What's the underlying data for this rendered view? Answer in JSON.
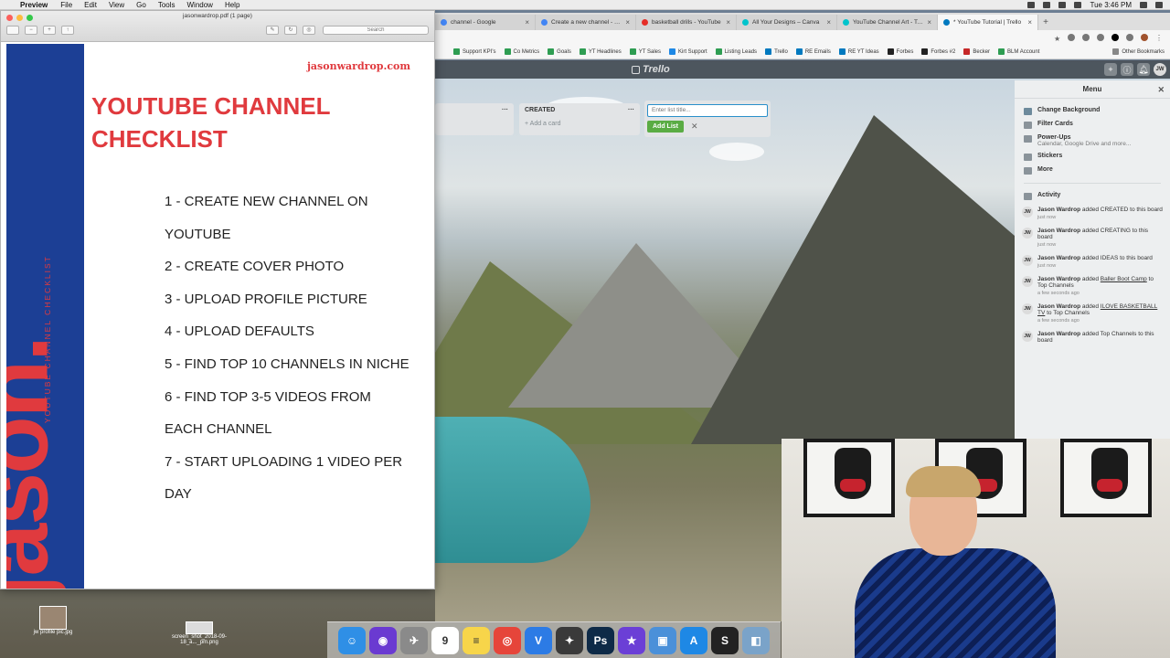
{
  "menubar": {
    "app": "Preview",
    "items": [
      "File",
      "Edit",
      "View",
      "Go",
      "Tools",
      "Window",
      "Help"
    ],
    "clock": "Tue 3:46 PM"
  },
  "chrome": {
    "tabs": [
      {
        "title": "channel - Google",
        "active": false,
        "color": "#4285f4"
      },
      {
        "title": "Create a new channel - YouTube",
        "active": false,
        "color": "#4285f4"
      },
      {
        "title": "basketball drills - YouTube",
        "active": false,
        "color": "#e52d27"
      },
      {
        "title": "All Your Designs – Canva",
        "active": false,
        "color": "#00c4cc"
      },
      {
        "title": "YouTube Channel Art - TextC",
        "active": false,
        "color": "#00c4cc"
      },
      {
        "title": "* YouTube Tutorial | Trello",
        "active": true,
        "color": "#0079bf"
      }
    ],
    "bookmarks": [
      "Support KPI's",
      "Co Metrics",
      "Goals",
      "YT Headlines",
      "YT Sales",
      "Kirt Support",
      "Listing Leads",
      "Trello",
      "RE Emails",
      "RE YT Ideas",
      "Forbes",
      "Forbes #2",
      "Becker",
      "BLM Account"
    ],
    "other_bookmarks": "Other Bookmarks"
  },
  "trello": {
    "logo": "Trello",
    "avatar": "JW",
    "lists": [
      {
        "title": "",
        "add_card": ""
      },
      {
        "title": "CREATED",
        "add_card": "+ Add a card"
      }
    ],
    "add_list": {
      "placeholder": "Enter list title...",
      "button": "Add List",
      "cancel": "✕"
    },
    "menu": {
      "title": "Menu",
      "close": "✕",
      "items": [
        {
          "label": "Change Background",
          "sub": ""
        },
        {
          "label": "Filter Cards",
          "sub": ""
        },
        {
          "label": "Power-Ups",
          "sub": "Calendar, Google Drive and more..."
        },
        {
          "label": "Stickers",
          "sub": ""
        },
        {
          "label": "More",
          "sub": ""
        }
      ],
      "activity_label": "Activity",
      "activity": [
        {
          "user": "Jason Wardrop",
          "pre": "added CREATED to this board",
          "link": "",
          "post": "",
          "when": "just now"
        },
        {
          "user": "Jason Wardrop",
          "pre": "added CREATING to this board",
          "link": "",
          "post": "",
          "when": "just now"
        },
        {
          "user": "Jason Wardrop",
          "pre": "added IDEAS to this board",
          "link": "",
          "post": "",
          "when": "just now"
        },
        {
          "user": "Jason Wardrop",
          "pre": "added",
          "link": "Baller Boot Camp",
          "post": "to Top Channels",
          "when": "a few seconds ago"
        },
        {
          "user": "Jason Wardrop",
          "pre": "added",
          "link": "ILOVE BASKETBALL TV",
          "post": "to Top Channels",
          "when": "a few seconds ago"
        },
        {
          "user": "Jason Wardrop",
          "pre": "added Top Channels to this board",
          "link": "",
          "post": "",
          "when": ""
        }
      ]
    }
  },
  "preview": {
    "window_title": "jasonwardrop.pdf (1 page)",
    "search_placeholder": "Search",
    "doc": {
      "site": "jasonwardrop.com",
      "title": "YOUTUBE CHANNEL CHECKLIST",
      "logo": "jason.",
      "vertical_label": "YOUTUBE CHANNEL CHECKLIST",
      "steps": [
        "1 - CREATE NEW CHANNEL ON YOUTUBE",
        "2 - CREATE COVER PHOTO",
        "3 - UPLOAD PROFILE PICTURE",
        "4 - UPLOAD DEFAULTS",
        "5 - FIND TOP 10 CHANNELS IN NICHE",
        "6 - FIND TOP 3-5 VIDEOS FROM EACH CHANNEL",
        "7 - START UPLOADING 1 VIDEO PER DAY"
      ]
    }
  },
  "desktop": {
    "icons": [
      {
        "label": "jw profile pic.jpg"
      },
      {
        "label": "screen_shot_2018-09-18_a..._pm.png"
      }
    ]
  },
  "dock": {
    "apps": [
      {
        "name": "Finder",
        "color": "#2f8fe6",
        "glyph": "☺"
      },
      {
        "name": "Siri",
        "color": "#6a3ad1",
        "glyph": "◉"
      },
      {
        "name": "Launchpad",
        "color": "#8a8a8a",
        "glyph": "✈"
      },
      {
        "name": "Calendar",
        "color": "#ffffff",
        "glyph": "9"
      },
      {
        "name": "Notes",
        "color": "#f7d54a",
        "glyph": "≡"
      },
      {
        "name": "Chrome",
        "color": "#e6453a",
        "glyph": "◎"
      },
      {
        "name": "Vectorize",
        "color": "#2c7be5",
        "glyph": "V"
      },
      {
        "name": "Photo Booth",
        "color": "#3a3a3a",
        "glyph": "✦"
      },
      {
        "name": "Photoshop",
        "color": "#0e2a47",
        "glyph": "Ps"
      },
      {
        "name": "iMovie",
        "color": "#6b3fd6",
        "glyph": "★"
      },
      {
        "name": "Screen Capture",
        "color": "#4a90d9",
        "glyph": "▣"
      },
      {
        "name": "App Store",
        "color": "#1e88e5",
        "glyph": "A"
      },
      {
        "name": "Scrivener",
        "color": "#222222",
        "glyph": "S"
      },
      {
        "name": "Preview",
        "color": "#7aa3c9",
        "glyph": "◧"
      }
    ]
  }
}
